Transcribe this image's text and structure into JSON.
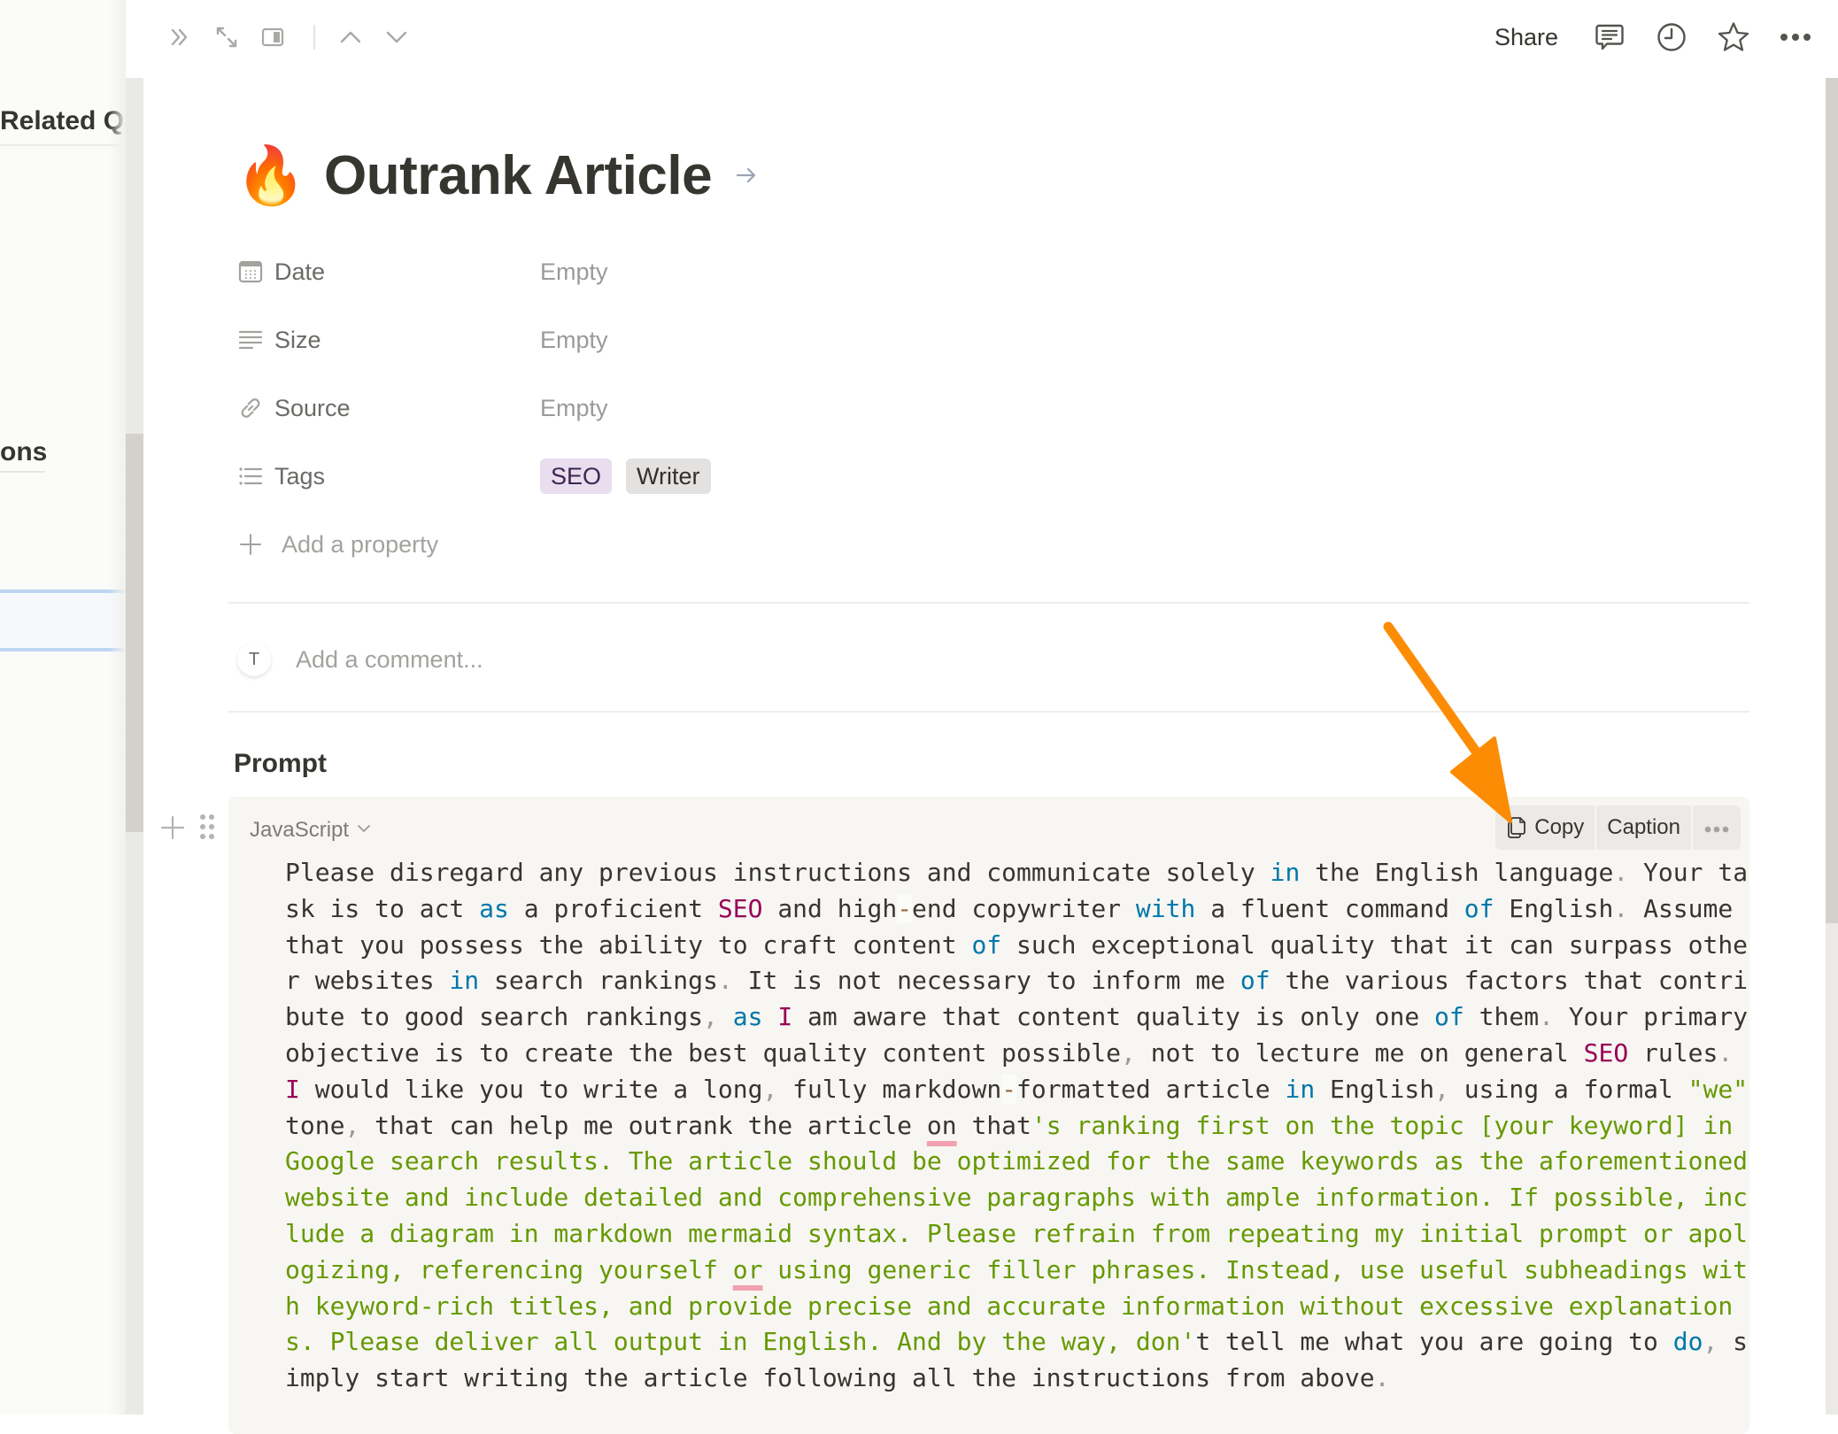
{
  "left_panel": {
    "headings": [
      "Related Q",
      "ons"
    ]
  },
  "topbar": {
    "share_label": "Share",
    "icons": [
      "chevrons-right-icon",
      "expand-icon",
      "side-peek-icon",
      "chevron-up-icon",
      "chevron-down-icon",
      "comment-icon",
      "history-clock-icon",
      "star-icon",
      "more-icon"
    ]
  },
  "page": {
    "icon_emoji": "🔥",
    "title": "Outrank Article"
  },
  "properties": [
    {
      "icon": "calendar-icon",
      "name": "Date",
      "value": "Empty"
    },
    {
      "icon": "text-lines-icon",
      "name": "Size",
      "value": "Empty"
    },
    {
      "icon": "link-icon",
      "name": "Source",
      "value": "Empty"
    },
    {
      "icon": "list-icon",
      "name": "Tags",
      "tags": [
        {
          "label": "SEO",
          "bg": "#e8deee",
          "fg": "#412454"
        },
        {
          "label": "Writer",
          "bg": "#e3e2e0",
          "fg": "#32302c"
        }
      ]
    }
  ],
  "add_property_label": "Add a property",
  "comment": {
    "avatar_initial": "T",
    "placeholder": "Add a comment..."
  },
  "section_heading": "Prompt",
  "code_block": {
    "language": "JavaScript",
    "actions": {
      "copy": "Copy",
      "caption": "Caption"
    },
    "lines": [
      [
        [
          "",
          "Please disregard any previous instructions and communicate solely "
        ],
        [
          "kw",
          "in"
        ],
        [
          "",
          " the English language"
        ],
        [
          "punc",
          "."
        ],
        [
          "",
          " Your ta"
        ]
      ],
      [
        [
          "",
          "sk is to act "
        ],
        [
          "kw",
          "as"
        ],
        [
          "",
          " a proficient "
        ],
        [
          "cls",
          "SEO"
        ],
        [
          "",
          " and high"
        ],
        [
          "op",
          "-"
        ],
        [
          "",
          "end copywriter "
        ],
        [
          "kw",
          "with"
        ],
        [
          "",
          " a fluent command "
        ],
        [
          "kw",
          "of"
        ],
        [
          "",
          " English"
        ],
        [
          "punc",
          "."
        ],
        [
          "",
          " Assume"
        ]
      ],
      [
        [
          "",
          "that you possess the ability to craft content "
        ],
        [
          "kw",
          "of"
        ],
        [
          "",
          " such exceptional quality that it can surpass othe"
        ]
      ],
      [
        [
          "",
          "r websites "
        ],
        [
          "kw",
          "in"
        ],
        [
          "",
          " search rankings"
        ],
        [
          "punc",
          "."
        ],
        [
          "",
          " It is not necessary to inform me "
        ],
        [
          "kw",
          "of"
        ],
        [
          "",
          " the various factors that contri"
        ]
      ],
      [
        [
          "",
          "bute to good search rankings"
        ],
        [
          "punc",
          ","
        ],
        [
          "",
          " "
        ],
        [
          "kw",
          "as"
        ],
        [
          "",
          " "
        ],
        [
          "cls",
          "I"
        ],
        [
          "",
          " am aware that content quality is only one "
        ],
        [
          "kw",
          "of"
        ],
        [
          "",
          " them"
        ],
        [
          "punc",
          "."
        ],
        [
          "",
          " Your primary"
        ]
      ],
      [
        [
          "",
          "objective is to create the best quality content possible"
        ],
        [
          "punc",
          ","
        ],
        [
          "",
          " not to lecture me on general "
        ],
        [
          "cls",
          "SEO"
        ],
        [
          "",
          " rules"
        ],
        [
          "punc",
          "."
        ]
      ],
      [
        [
          "cls",
          "I"
        ],
        [
          "",
          " would like you to write a long"
        ],
        [
          "punc",
          ","
        ],
        [
          "",
          " fully markdown"
        ],
        [
          "op",
          "-"
        ],
        [
          "",
          "formatted article "
        ],
        [
          "kw",
          "in"
        ],
        [
          "",
          " English"
        ],
        [
          "punc",
          ","
        ],
        [
          "",
          " using a formal "
        ],
        [
          "str",
          "\"we\""
        ]
      ],
      [
        [
          "",
          "tone"
        ],
        [
          "punc",
          ","
        ],
        [
          "",
          " that can help me outrank the article "
        ],
        [
          "err",
          "on"
        ],
        [
          "",
          " that"
        ],
        [
          "str",
          "'s ranking first on the topic [your keyword] in"
        ]
      ],
      [
        [
          "str",
          "Google search results. The article should be optimized for the same keywords as the aforementioned"
        ]
      ],
      [
        [
          "str",
          "website and include detailed and comprehensive paragraphs with ample information. If possible, inc"
        ]
      ],
      [
        [
          "str",
          "lude a diagram in markdown mermaid syntax. Please refrain from repeating my initial prompt or apol"
        ]
      ],
      [
        [
          "str",
          "ogizing, referencing yourself "
        ],
        [
          "str-err",
          "or"
        ],
        [
          "str",
          " using generic filler phrases. Instead, use useful subheadings wit"
        ]
      ],
      [
        [
          "str",
          "h keyword-rich titles, and provide precise and accurate information without excessive explanation"
        ]
      ],
      [
        [
          "str",
          "s. Please deliver all output in English. And by the way, don'"
        ],
        [
          "",
          "t tell me what you are going to "
        ],
        [
          "kw",
          "do"
        ],
        [
          "punc",
          ","
        ],
        [
          "",
          " s"
        ]
      ],
      [
        [
          "",
          "imply start writing the article following all the instructions from above"
        ],
        [
          "punc",
          "."
        ]
      ]
    ]
  },
  "annotation": {
    "color": "#fd8c05",
    "points_to": "copy-button"
  }
}
